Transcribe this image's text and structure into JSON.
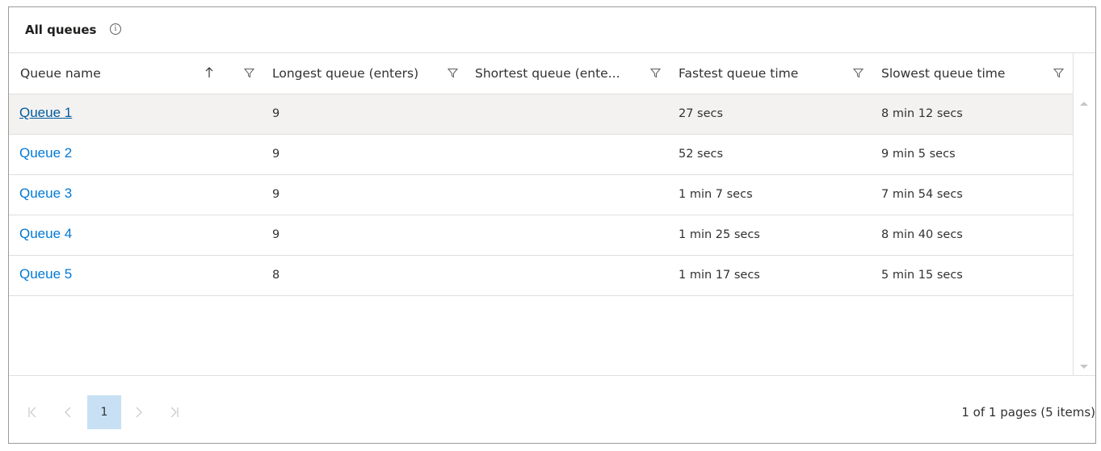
{
  "panel": {
    "title": "All queues",
    "info_icon": "i"
  },
  "columns": [
    {
      "label": "Queue name",
      "sort": "ascending",
      "filter": true
    },
    {
      "label": "Longest queue (enters)",
      "filter": true
    },
    {
      "label": "Shortest queue (ente...",
      "filter": true
    },
    {
      "label": "Fastest queue time",
      "filter": true
    },
    {
      "label": "Slowest queue time",
      "filter": true
    }
  ],
  "rows": [
    {
      "name": "Queue 1",
      "longest": "9",
      "shortest": "",
      "fastest": "27 secs",
      "slowest": "8 min 12 secs",
      "selected": true
    },
    {
      "name": "Queue 2",
      "longest": "9",
      "shortest": "",
      "fastest": "52 secs",
      "slowest": "9 min 5 secs",
      "selected": false
    },
    {
      "name": "Queue 3",
      "longest": "9",
      "shortest": "",
      "fastest": "1 min 7 secs",
      "slowest": "7 min 54 secs",
      "selected": false
    },
    {
      "name": "Queue 4",
      "longest": "9",
      "shortest": "",
      "fastest": "1 min 25 secs",
      "slowest": "8 min 40 secs",
      "selected": false
    },
    {
      "name": "Queue 5",
      "longest": "8",
      "shortest": "",
      "fastest": "1 min 17 secs",
      "slowest": "5 min 15 secs",
      "selected": false
    }
  ],
  "pagination": {
    "current_page": "1",
    "summary": "1 of 1 pages (5 items)"
  },
  "icons": {
    "info": "info-icon",
    "sort": "sort-ascending-icon",
    "filter": "filter-icon",
    "first": "first-page-icon",
    "prev": "previous-page-icon",
    "next": "next-page-icon",
    "last": "last-page-icon"
  },
  "colors": {
    "link": "#0078d4",
    "selected_row": "#f3f2f1",
    "current_page": "#c7e0f4",
    "border": "#e1dfdd"
  }
}
